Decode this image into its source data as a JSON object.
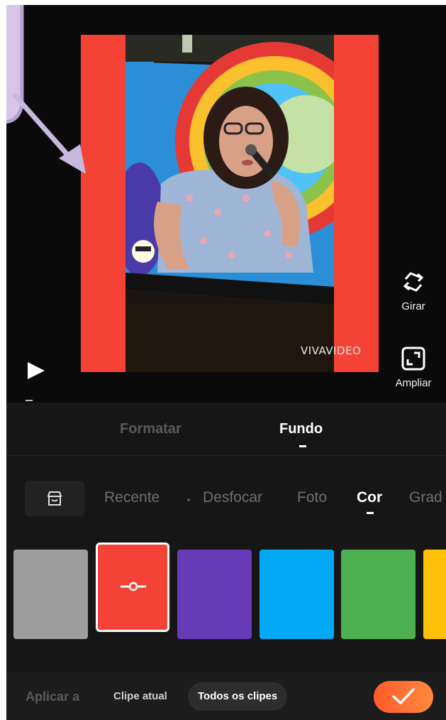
{
  "preview": {
    "background_color": "#f44336",
    "watermark": "VIVAVIDEO",
    "play_icon": "play-icon",
    "tools": [
      {
        "label": "Girar",
        "icon": "rotate-icon"
      },
      {
        "label": "Ampliar",
        "icon": "expand-icon"
      }
    ]
  },
  "tabs": {
    "items": [
      "Formatar",
      "Fundo"
    ],
    "active": "Fundo"
  },
  "background_tabs": {
    "store_icon": "store-icon",
    "items": [
      "Recente",
      "Desfocar",
      "Foto",
      "Cor",
      "Grad"
    ],
    "active": "Cor"
  },
  "swatches": {
    "colors": [
      "#9e9e9e",
      "#f44336",
      "#673ab7",
      "#03a9f4",
      "#4caf50",
      "#ffc107"
    ],
    "selected_index": 1
  },
  "bottom_bar": {
    "apply_label": "Aplicar a",
    "options": [
      "Clipe atual",
      "Todos os clipes"
    ],
    "selected_option": "Todos os clipes",
    "confirm_icon": "checkmark-icon",
    "accent": "#ff6a33"
  }
}
